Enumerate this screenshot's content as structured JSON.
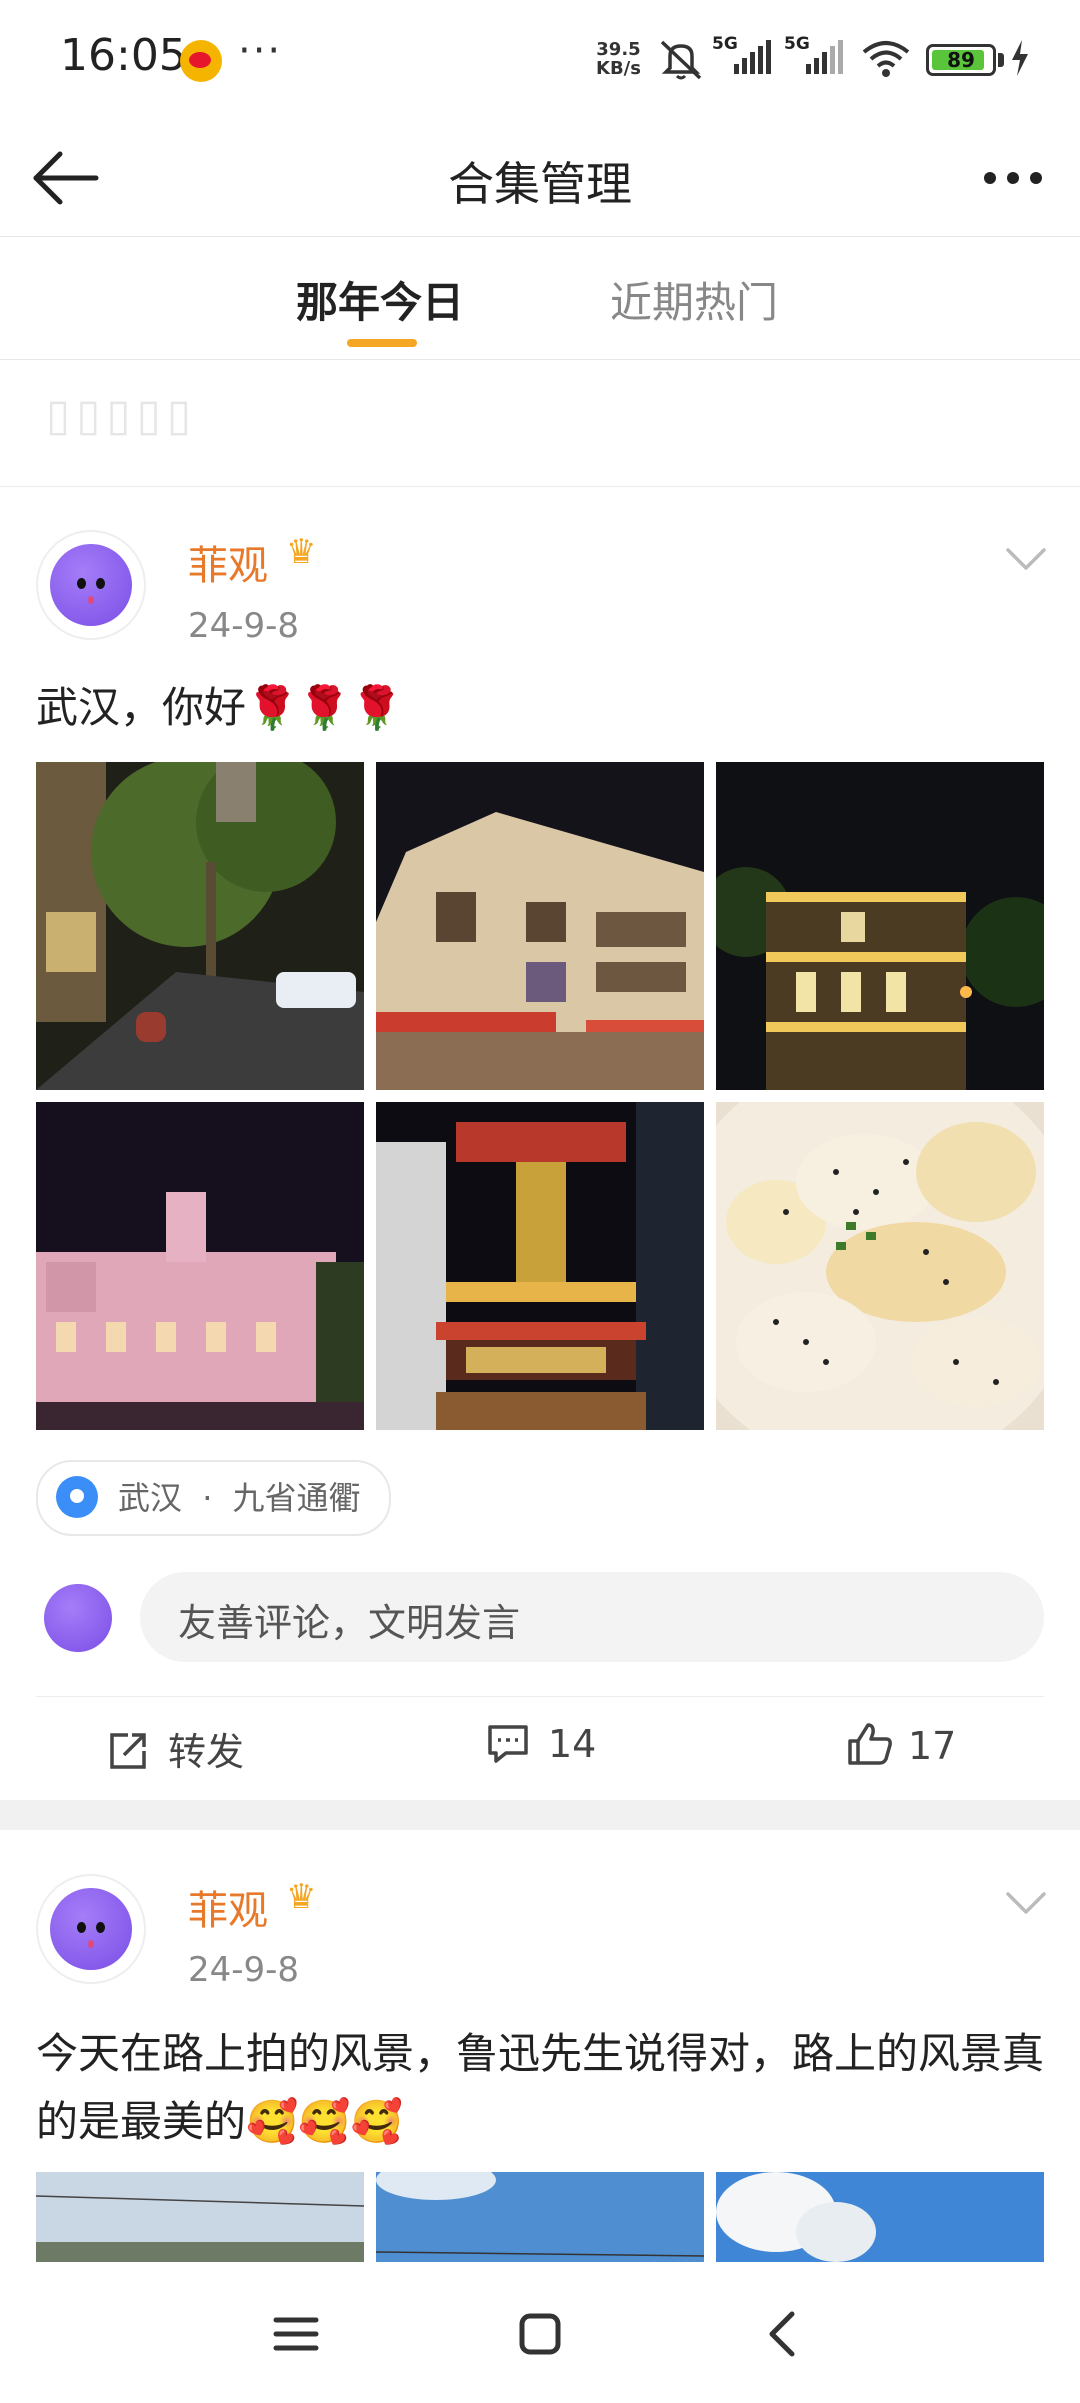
{
  "status_bar": {
    "time": "16:05",
    "dots": "···",
    "net_speed_value": "39.5",
    "net_speed_unit": "KB/s",
    "signal1_label": "5G",
    "signal2_label": "5G",
    "battery": "89",
    "battery_level": 0.89
  },
  "header": {
    "title": "合集管理"
  },
  "tabs": [
    {
      "label": "那年今日",
      "active": true
    },
    {
      "label": "近期热门",
      "active": false
    }
  ],
  "posts": [
    {
      "username": "菲观",
      "date": "24-9-8",
      "text": "武汉，你好🌹🌹🌹",
      "location_city": "武汉",
      "location_sep": "·",
      "location_place": "九省通衢",
      "comment_placeholder": "友善评论，文明发言",
      "repost_label": "转发",
      "comment_count": "14",
      "like_count": "17"
    },
    {
      "username": "菲观",
      "date": "24-9-8",
      "text": "今天在路上拍的风景，鲁迅先生说得对，路上的风景真的是最美的🥰🥰🥰"
    }
  ],
  "colors": {
    "accent": "#f5a623",
    "username": "#e8792b",
    "location_pin": "#3b8df7",
    "battery": "#5ac43a"
  },
  "icons": [
    "weibo-icon",
    "mute-icon",
    "wifi-icon",
    "charging-icon",
    "back-arrow-icon",
    "more-icon",
    "chevron-down-icon",
    "location-icon",
    "repost-icon",
    "comment-icon",
    "like-icon",
    "menu-icon",
    "home-icon",
    "back-icon"
  ]
}
